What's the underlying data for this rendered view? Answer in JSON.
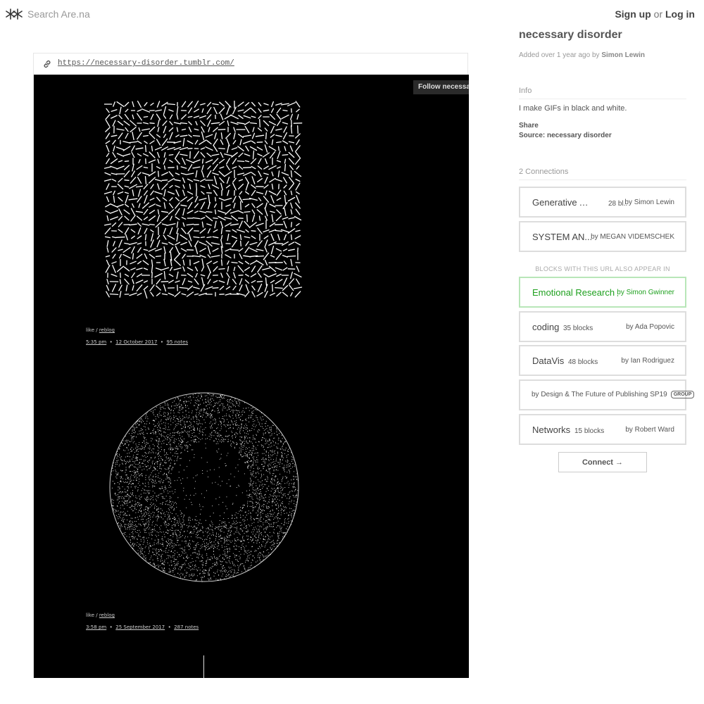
{
  "header": {
    "search_placeholder": "Search Are.na",
    "sign_up": "Sign up",
    "or": "or",
    "log_in": "Log in"
  },
  "block": {
    "url": "https://necessary-disorder.tumblr.com/",
    "follow_button": "Follow necessary-disorder",
    "posts": [
      {
        "like": "like",
        "sep": " / ",
        "reblog": "reblog",
        "time": "5:35 pm",
        "date": "12 October 2017",
        "notes": "95 notes"
      },
      {
        "like": "like",
        "sep": " / ",
        "reblog": "reblog",
        "time": "3:58 pm",
        "date": "25 September 2017",
        "notes": "287 notes"
      }
    ]
  },
  "sidebar": {
    "title": "necessary disorder",
    "added_prefix": "Added over 1 year ago by",
    "added_by": "Simon Lewin",
    "info_heading": "Info",
    "description": "I make GIFs in black and white.",
    "share": "Share",
    "source": "Source: necessary disorder",
    "connections_heading": "2 Connections",
    "connections": [
      {
        "name": "Generative Artists",
        "count": "28 bl..",
        "by": "by Simon Lewin"
      },
      {
        "name": "SYSTEM AN...",
        "count": "",
        "by": "by MEGAN VIDEMSCHEK"
      }
    ],
    "also_appear_label": "BLOCKS WITH THIS URL ALSO APPEAR IN",
    "also_appear": [
      {
        "name": "Emotional Research",
        "count": ",",
        "by": "by Simon Gwinner",
        "highlight": "#1ea01e"
      },
      {
        "name": "coding",
        "count": "35 blocks",
        "by": "by Ada Popovic"
      },
      {
        "name": "DataVis",
        "count": "48 blocks",
        "by": "by Ian Rodriguez"
      },
      {
        "name": "",
        "count": "",
        "by": "by Design & The Future of Publishing SP19",
        "badge": "GROUP"
      },
      {
        "name": "Networks",
        "count": "15 blocks",
        "by": "by Robert Ward"
      }
    ],
    "connect_button": "Connect →"
  }
}
